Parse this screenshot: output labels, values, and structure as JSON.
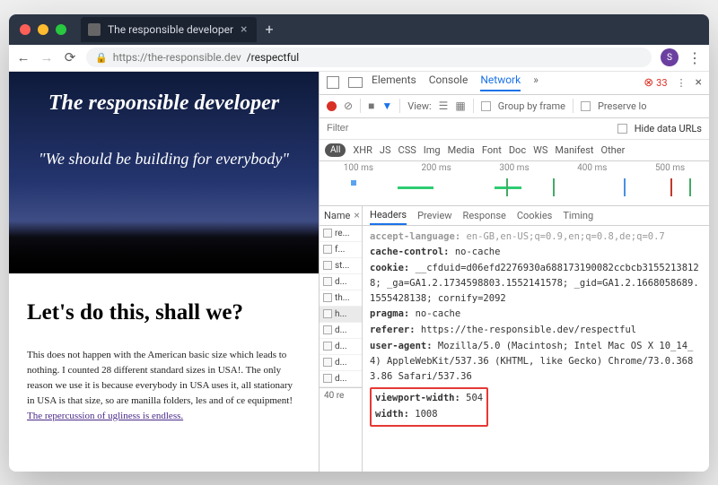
{
  "titlebar": {
    "tab_title": "The responsible developer",
    "close_glyph": "×",
    "add_glyph": "+"
  },
  "urlbar": {
    "back": "←",
    "fwd": "→",
    "reload": "⟳",
    "lock": "🔒",
    "host": "https://the-responsible.dev",
    "path": "/respectful",
    "avatar_letter": "S",
    "menu": "⋮"
  },
  "page": {
    "hero_title": "The responsible developer",
    "hero_quote": "\"We should be building for everybody\"",
    "heading": "Let's do this, shall we?",
    "body_1": "This does not happen with the American basic size which leads to nothing. I counted 28 different standard sizes in USA!. The only reason we use it is because everybody in USA uses it, all stationary in USA is that size, so are manilla folders, les and of ce equipment! ",
    "body_link": "The repercussion of ugliness is endless."
  },
  "devtools": {
    "tabs": {
      "elements": "Elements",
      "console": "Console",
      "network": "Network",
      "more": "»"
    },
    "error_count": "33",
    "settings": "⋮",
    "close": "×",
    "toolbar": {
      "clear": "⊘",
      "view": "View:",
      "group": "Group by frame",
      "preserve": "Preserve lo"
    },
    "filter": {
      "placeholder": "Filter",
      "hide": "Hide data URLs"
    },
    "types": [
      "All",
      "XHR",
      "JS",
      "CSS",
      "Img",
      "Media",
      "Font",
      "Doc",
      "WS",
      "Manifest",
      "Other"
    ],
    "timeline_ticks": [
      "100 ms",
      "200 ms",
      "300 ms",
      "400 ms",
      "500 ms"
    ],
    "reqlist_head": "Name",
    "requests": [
      "re...",
      "f...",
      "st...",
      "d...",
      "th...",
      "h...",
      "d...",
      "d...",
      "d...",
      "d..."
    ],
    "selected_index": 5,
    "req_count": "40 re",
    "detail_tabs": [
      "Headers",
      "Preview",
      "Response",
      "Cookies",
      "Timing"
    ],
    "headers": {
      "accept_language_k": "accept-language:",
      "accept_language_v": "en-GB,en-US;q=0.9,en;q=0.8,de;q=0.7",
      "cache_control_k": "cache-control:",
      "cache_control_v": "no-cache",
      "cookie_k": "cookie:",
      "cookie_v": "__cfduid=d06efd2276930a688173190082ccbcb3155213812 8; _ga=GA1.2.1734598803.1552141578; _gid=GA1.2.1668058689. 1555428138; cornify=2092",
      "pragma_k": "pragma:",
      "pragma_v": "no-cache",
      "referer_k": "referer:",
      "referer_v": "https://the-responsible.dev/respectful",
      "ua_k": "user-agent:",
      "ua_v": "Mozilla/5.0 (Macintosh; Intel Mac OS X 10_14_4) AppleWebKit/537.36 (KHTML, like Gecko) Chrome/73.0.3683.86 Safari/537.36",
      "vw_k": "viewport-width:",
      "vw_v": "504",
      "w_k": "width:",
      "w_v": "1008"
    }
  }
}
